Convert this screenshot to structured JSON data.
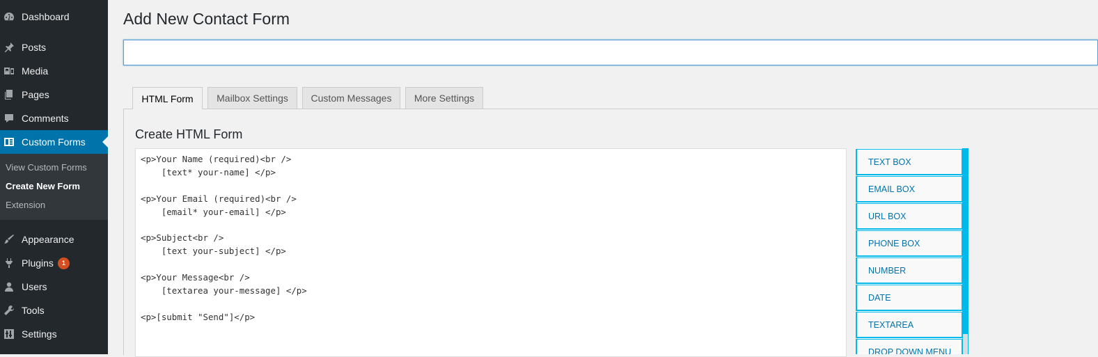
{
  "sidebar": {
    "items": [
      {
        "label": "Dashboard",
        "icon": "dashboard-icon"
      },
      {
        "label": "Posts",
        "icon": "pushpin-icon"
      },
      {
        "label": "Media",
        "icon": "media-icon"
      },
      {
        "label": "Pages",
        "icon": "pages-icon"
      },
      {
        "label": "Comments",
        "icon": "comment-icon"
      },
      {
        "label": "Custom Forms",
        "icon": "forms-icon"
      },
      {
        "label": "Appearance",
        "icon": "brush-icon"
      },
      {
        "label": "Plugins",
        "icon": "plug-icon",
        "badge": "1"
      },
      {
        "label": "Users",
        "icon": "user-icon"
      },
      {
        "label": "Tools",
        "icon": "wrench-icon"
      },
      {
        "label": "Settings",
        "icon": "settings-icon"
      }
    ],
    "submenu": [
      {
        "label": "View Custom Forms"
      },
      {
        "label": "Create New Form"
      },
      {
        "label": "Extension"
      }
    ]
  },
  "page": {
    "title": "Add New Contact Form",
    "title_input_value": ""
  },
  "tabs": [
    {
      "label": "HTML Form"
    },
    {
      "label": "Mailbox Settings"
    },
    {
      "label": "Custom Messages"
    },
    {
      "label": "More Settings"
    }
  ],
  "editor": {
    "section_title": "Create HTML Form",
    "code": "<p>Your Name (required)<br />\n    [text* your-name] </p>\n\n<p>Your Email (required)<br />\n    [email* your-email] </p>\n\n<p>Subject<br />\n    [text your-subject] </p>\n\n<p>Your Message<br />\n    [textarea your-message] </p>\n\n<p>[submit \"Send\"]</p>"
  },
  "field_buttons": [
    {
      "label": "TEXT BOX"
    },
    {
      "label": "EMAIL BOX"
    },
    {
      "label": "URL BOX"
    },
    {
      "label": "PHONE BOX"
    },
    {
      "label": "NUMBER"
    },
    {
      "label": "DATE"
    },
    {
      "label": "TEXTAREA"
    },
    {
      "label": "DROP DOWN MENU"
    }
  ],
  "colors": {
    "sidebar_bg": "#23282d",
    "active_menu": "#0073aa",
    "accent_cyan": "#00b9eb",
    "badge": "#d54e21"
  }
}
